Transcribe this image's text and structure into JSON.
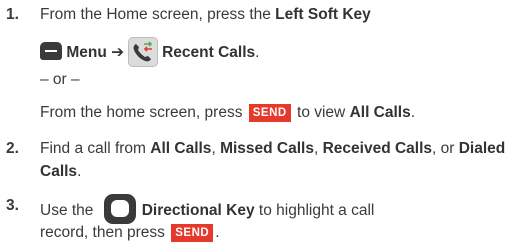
{
  "steps": [
    {
      "number": "1.",
      "line1": {
        "pre": "From the Home screen, press the ",
        "bold": "Left Soft Key"
      },
      "line2": {
        "menu": "Menu",
        "arrow": "➔",
        "recent": "Recent Calls",
        "end": "."
      },
      "or": "– or –",
      "line4": {
        "pre": "From the home screen, press ",
        "send": "SEND",
        "mid": " to view ",
        "bold": "All Calls",
        "end": "."
      }
    },
    {
      "number": "2.",
      "line1": {
        "pre": "Find a call from ",
        "b1": "All Calls",
        "sep1": ", ",
        "b2": "Missed Calls",
        "sep2": ", ",
        "b3": "Received Calls",
        "sep3": ", or ",
        "b4": "Dialed"
      },
      "line2": {
        "bold": "Calls",
        "end": "."
      }
    },
    {
      "number": "3.",
      "line1": {
        "pre": "Use the ",
        "bold": "Directional Key",
        "post": " to highlight a call"
      },
      "line2": {
        "pre": "record, then press ",
        "send": "SEND",
        "end": "."
      }
    }
  ],
  "icons": {
    "left_soft_key": "left-soft-key-icon",
    "recent_calls": "recent-calls-icon",
    "directional_key": "directional-key-icon"
  }
}
